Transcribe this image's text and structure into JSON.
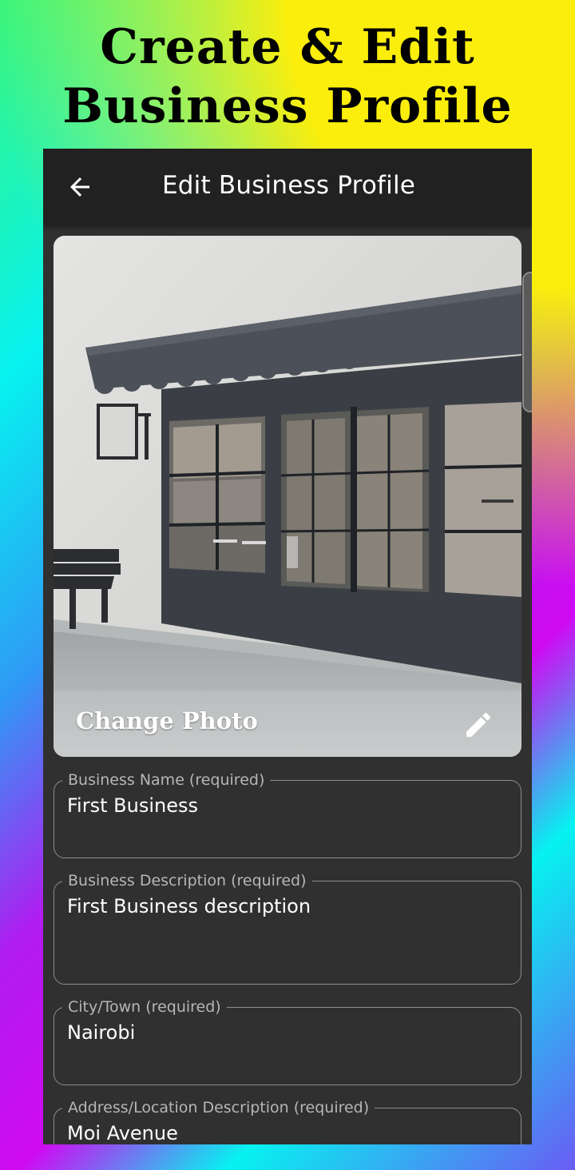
{
  "promo": {
    "title_line1": "Create & Edit",
    "title_line2": "Business Profile"
  },
  "appbar": {
    "back_icon": "arrow-back-icon",
    "title": "Edit Business Profile"
  },
  "photo": {
    "change_label": "Change Photo",
    "edit_icon": "pencil-icon"
  },
  "form": {
    "fields": [
      {
        "label": "Business Name (required)",
        "value": "First Business"
      },
      {
        "label": "Business Description (required)",
        "value": "First Business description"
      },
      {
        "label": "City/Town (required)",
        "value": "Nairobi"
      },
      {
        "label": "Address/Location Description (required)",
        "value": "Moi Avenue"
      }
    ]
  },
  "colors": {
    "appbar": "#212121",
    "surface": "#303030",
    "outline": "#8d8d8d"
  }
}
